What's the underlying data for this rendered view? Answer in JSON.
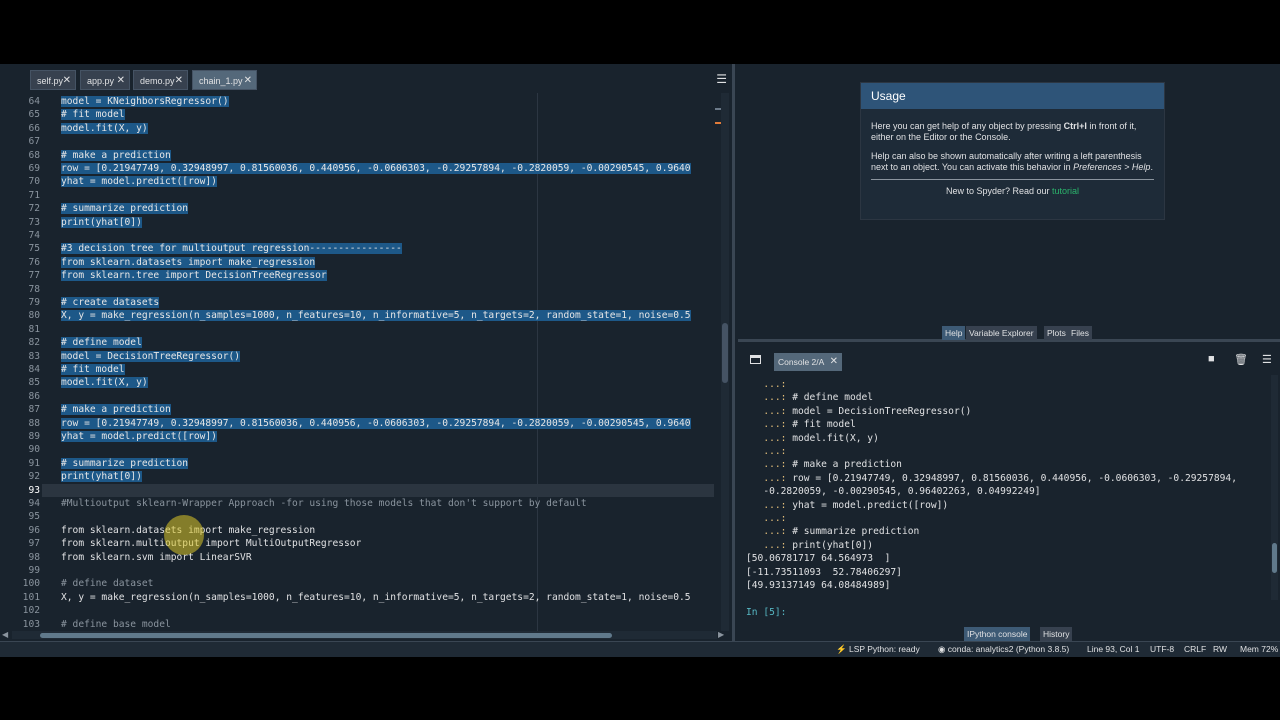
{
  "editor": {
    "tabs": [
      {
        "label": "self.py",
        "active": false
      },
      {
        "label": "app.py",
        "active": false
      },
      {
        "label": "demo.py",
        "active": false
      },
      {
        "label": "chain_1.py",
        "active": true
      }
    ],
    "menu_icon": "hamburger-menu-icon",
    "close_icon": "close-icon",
    "current_line": "93",
    "lines": [
      {
        "n": "64",
        "t": "model = KNeighborsRegressor()",
        "sel": true
      },
      {
        "n": "65",
        "t": "# fit model",
        "sel": true
      },
      {
        "n": "66",
        "t": "model.fit(X, y)",
        "sel": true
      },
      {
        "n": "67",
        "t": "",
        "sel": true
      },
      {
        "n": "68",
        "t": "# make a prediction",
        "sel": true
      },
      {
        "n": "69",
        "t": "row = [0.21947749, 0.32948997, 0.81560036, 0.440956, -0.0606303, -0.29257894, -0.2820059, -0.00290545, 0.9640",
        "sel": true
      },
      {
        "n": "70",
        "t": "yhat = model.predict([row])",
        "sel": true
      },
      {
        "n": "71",
        "t": "",
        "sel": true
      },
      {
        "n": "72",
        "t": "# summarize prediction",
        "sel": true
      },
      {
        "n": "73",
        "t": "print(yhat[0])",
        "sel": true
      },
      {
        "n": "74",
        "t": "",
        "sel": true
      },
      {
        "n": "75",
        "t": "#3 decision tree for multioutput regression----------------",
        "sel": true
      },
      {
        "n": "76",
        "t": "from sklearn.datasets import make_regression",
        "sel": true
      },
      {
        "n": "77",
        "t": "from sklearn.tree import DecisionTreeRegressor",
        "sel": true
      },
      {
        "n": "78",
        "t": "",
        "sel": true
      },
      {
        "n": "79",
        "t": "# create datasets",
        "sel": true
      },
      {
        "n": "80",
        "t": "X, y = make_regression(n_samples=1000, n_features=10, n_informative=5, n_targets=2, random_state=1, noise=0.5",
        "sel": true
      },
      {
        "n": "81",
        "t": "",
        "sel": true
      },
      {
        "n": "82",
        "t": "# define model",
        "sel": true
      },
      {
        "n": "83",
        "t": "model = DecisionTreeRegressor()",
        "sel": true
      },
      {
        "n": "84",
        "t": "# fit model",
        "sel": true
      },
      {
        "n": "85",
        "t": "model.fit(X, y)",
        "sel": true
      },
      {
        "n": "86",
        "t": "",
        "sel": true
      },
      {
        "n": "87",
        "t": "# make a prediction",
        "sel": true
      },
      {
        "n": "88",
        "t": "row = [0.21947749, 0.32948997, 0.81560036, 0.440956, -0.0606303, -0.29257894, -0.2820059, -0.00290545, 0.9640",
        "sel": true
      },
      {
        "n": "89",
        "t": "yhat = model.predict([row])",
        "sel": true
      },
      {
        "n": "90",
        "t": "",
        "sel": true
      },
      {
        "n": "91",
        "t": "# summarize prediction",
        "sel": true
      },
      {
        "n": "92",
        "t": "print(yhat[0])",
        "sel": true
      },
      {
        "n": "93",
        "t": "",
        "sel": false
      },
      {
        "n": "94",
        "t": "#Multioutput sklearn-Wrapper Approach -for using those models that don't support by default",
        "sel": false,
        "kind": "comment"
      },
      {
        "n": "95",
        "t": "",
        "sel": false
      },
      {
        "n": "96",
        "t": "from sklearn.datasets import make_regression",
        "sel": false,
        "kind": "import"
      },
      {
        "n": "97",
        "t": "from sklearn.multioutput import MultiOutputRegressor",
        "sel": false,
        "kind": "import"
      },
      {
        "n": "98",
        "t": "from sklearn.svm import LinearSVR",
        "sel": false,
        "kind": "import"
      },
      {
        "n": "99",
        "t": "",
        "sel": false
      },
      {
        "n": "100",
        "t": "# define dataset",
        "sel": false,
        "kind": "comment"
      },
      {
        "n": "101",
        "t": "X, y = make_regression(n_samples=1000, n_features=10, n_informative=5, n_targets=2, random_state=1, noise=0.5",
        "sel": false
      },
      {
        "n": "102",
        "t": "",
        "sel": false
      },
      {
        "n": "103",
        "t": "# define base model",
        "sel": false,
        "kind": "comment"
      }
    ]
  },
  "help": {
    "title": "Usage",
    "p1_a": "Here you can get help of any object by pressing ",
    "p1_key": "Ctrl+I",
    "p1_b": " in front of it, either on the Editor or the Console.",
    "p2_a": "Help can also be shown automatically after writing a left parenthesis next to an object. You can activate this behavior in ",
    "p2_em": "Preferences > Help",
    "p2_b": ".",
    "foot": "New to Spyder? Read our ",
    "foot_link": "tutorial",
    "tabs": [
      "Help",
      "Variable Explorer",
      "Plots",
      "Files"
    ]
  },
  "console": {
    "tab_label": "Console 2/A",
    "lines": [
      {
        "p": "   ...: ",
        "t": ""
      },
      {
        "p": "   ...: ",
        "t": "# define model"
      },
      {
        "p": "   ...: ",
        "t": "model = DecisionTreeRegressor()"
      },
      {
        "p": "   ...: ",
        "t": "# fit model"
      },
      {
        "p": "   ...: ",
        "t": "model.fit(X, y)"
      },
      {
        "p": "   ...: ",
        "t": ""
      },
      {
        "p": "   ...: ",
        "t": "# make a prediction"
      },
      {
        "p": "   ...: ",
        "t": "row = [0.21947749, 0.32948997, 0.81560036, 0.440956, -0.0606303, -0.29257894,"
      },
      {
        "p": "",
        "t": "   -0.2820059, -0.00290545, 0.96402263, 0.04992249]"
      },
      {
        "p": "   ...: ",
        "t": "yhat = model.predict([row])"
      },
      {
        "p": "   ...: ",
        "t": ""
      },
      {
        "p": "   ...: ",
        "t": "# summarize prediction"
      },
      {
        "p": "   ...: ",
        "t": "print(yhat[0])"
      },
      {
        "p": "",
        "t": "[50.06781717 64.564973  ]"
      },
      {
        "p": "",
        "t": "[-11.73511093  52.78406297]"
      },
      {
        "p": "",
        "t": "[49.93137149 64.08484989]"
      },
      {
        "p": "",
        "t": ""
      },
      {
        "p": "In [5]: ",
        "t": "",
        "in": true
      }
    ],
    "tabs": [
      "IPython console",
      "History"
    ]
  },
  "status": {
    "lsp": "LSP Python: ready",
    "conda": "conda: analytics2 (Python 3.8.5)",
    "pos": "Line 93, Col 1",
    "enc": "UTF-8",
    "eol": "CRLF",
    "rw": "RW",
    "mem": "Mem 72%"
  },
  "colors": {
    "selection": "#1d5888",
    "background": "#19232d",
    "accent": "#2e5478"
  }
}
